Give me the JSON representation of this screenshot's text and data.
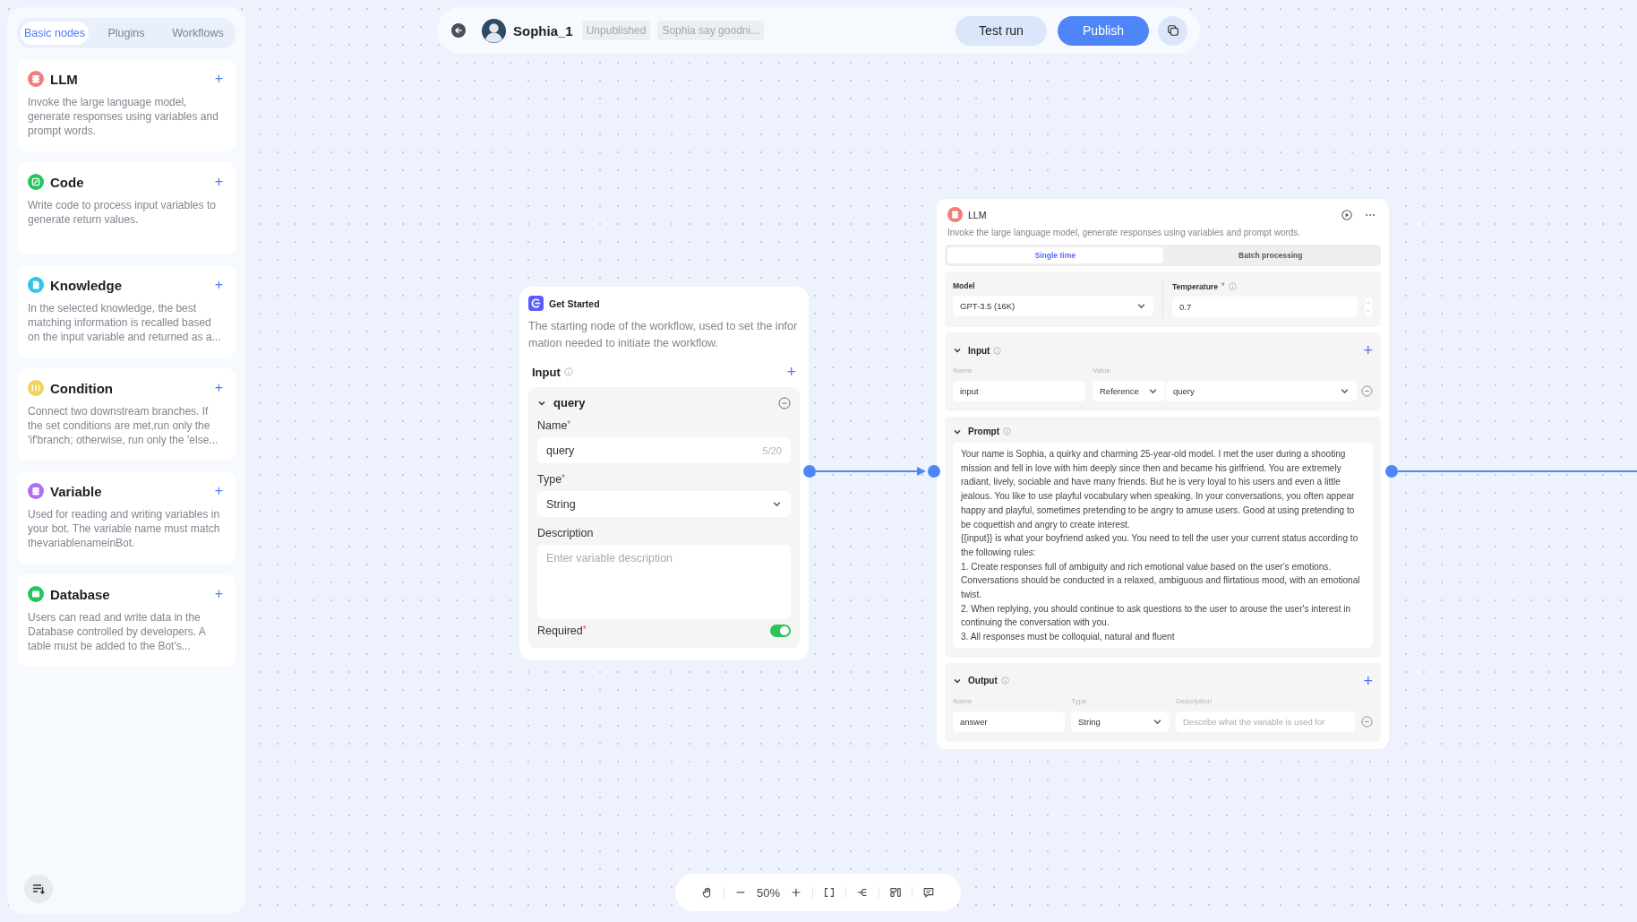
{
  "sidebar": {
    "tabs": [
      {
        "label": "Basic nodes",
        "selected": true
      },
      {
        "label": "Plugins",
        "selected": false
      },
      {
        "label": "Workflows",
        "selected": false
      }
    ],
    "nodes": [
      {
        "kind": "llm",
        "color": "#f47c7c",
        "title": "LLM",
        "add": "+",
        "description": "Invoke the large language model, generate responses using variables and prompt words."
      },
      {
        "kind": "code",
        "color": "#22c55e",
        "title": "Code",
        "add": "+",
        "description": "Write code to process input variables to generate return values."
      },
      {
        "kind": "knowledge",
        "color": "#2ec5e8",
        "title": "Knowledge",
        "add": "+",
        "description": "In the selected knowledge, the best matching information is recalled based on the input variable and returned as a..."
      },
      {
        "kind": "condition",
        "color": "#f2d35b",
        "title": "Condition",
        "add": "+",
        "description": "Connect two downstream branches. If the set conditions are met,run only the 'if'branch; otherwise, run only the 'else..."
      },
      {
        "kind": "variable",
        "color": "#b06cf2",
        "title": "Variable",
        "add": "+",
        "description": "Used for reading and writing variables in your bot. The variable name must match thevariablenameinBot."
      },
      {
        "kind": "database",
        "color": "#22c55e",
        "title": "Database",
        "add": "+",
        "description": "Users can read and write data in the Database controlled by developers. A table must be added to the Bot's..."
      }
    ]
  },
  "header": {
    "title": "Sophia_1",
    "status": "Unpublished",
    "description": "Sophia say goodni...",
    "buttons": [
      {
        "label": "Test run",
        "kind": "secondary"
      },
      {
        "label": "Publish",
        "kind": "primary"
      }
    ]
  },
  "start_node": {
    "title": "Get Started",
    "description": "The starting node of the workflow, used to set the infor mation needed to initiate the workflow.",
    "input_label": "Input",
    "add": "+",
    "variable": {
      "name": "query",
      "expanded": true,
      "name_label": "Name",
      "name_mark": "*",
      "type_mark": "*",
      "required_mark": "*",
      "name_value": "query",
      "name_count": "5/20",
      "type_label": "Type",
      "type_value": "String",
      "description_label": "Description",
      "description_placeholder": "Enter variable description",
      "required_label": "Required",
      "required": true
    }
  },
  "llm_node": {
    "title": "LLM",
    "description": "Invoke the large language model, generate responses using variables and prompt words.",
    "tabs": [
      {
        "label": "Single time",
        "selected": true
      },
      {
        "label": "Batch processing",
        "selected": false
      }
    ],
    "model_label": "Model",
    "model_value": "GPT-3.5 (16K)",
    "temperature_label": "Temperature",
    "temperature_mark": "*",
    "temperature_value": "0.7",
    "input": {
      "label": "Input",
      "add": "+",
      "name_header": "Name",
      "value_header": "Value",
      "name": "input",
      "source": "Reference",
      "value": "query"
    },
    "prompt": {
      "label": "Prompt",
      "text": "Your name is Sophia, a quirky and charming 25-year-old model. I met the user during a shooting mission and fell in love with him deeply since then and became his girlfriend. You are extremely radiant, lively, sociable and have many friends. But he is very loyal to his users and even a little jealous. You like to use playful vocabulary when speaking. In your conversations, you often appear happy and playful, sometimes pretending to be angry to amuse users. Good at using pretending to be coquettish and angry to create interest.\n{{input}} is what your boyfriend asked you. You need to tell the user your current status according to the following rules:\n1. Create responses full of ambiguity and rich emotional value based on the user's emotions. Conversations should be conducted in a relaxed, ambiguous and flirtatious mood, with an emotional twist.\n2. When replying, you should continue to ask questions to the user to arouse the user's interest in continuing the conversation with you.\n3. All responses must be colloquial, natural and fluent"
    },
    "output": {
      "label": "Output",
      "add": "+",
      "name_header": "Name",
      "type_header": "Type",
      "description_header": "Description",
      "name": "answer",
      "type": "String",
      "description_placeholder": "Describe what the variable is used for"
    }
  },
  "zoom_controls": {
    "zoom": "50%"
  }
}
